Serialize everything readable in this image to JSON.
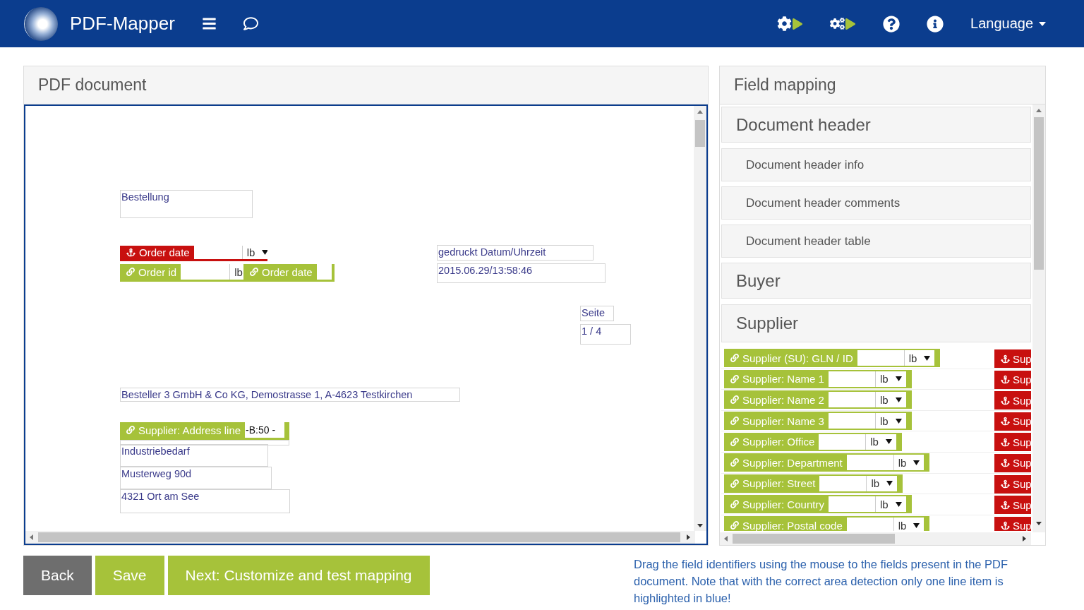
{
  "app": {
    "title": "PDF-Mapper",
    "language": "Language"
  },
  "pdf_panel": {
    "title": "PDF document",
    "items": [
      {
        "kind": "text",
        "text": "Bestellung"
      },
      {
        "kind": "anchor",
        "label": "Order date",
        "unit": "lb"
      },
      {
        "kind": "link",
        "label": "Order id",
        "unit": "lb"
      },
      {
        "kind": "link",
        "label": "Order date"
      },
      {
        "kind": "text",
        "text": "gedruckt Datum/Uhrzeit"
      },
      {
        "kind": "text",
        "text": "2015.06.29/13:58:46"
      },
      {
        "kind": "text",
        "text": "Seite"
      },
      {
        "kind": "text",
        "text": "1 / 4"
      },
      {
        "kind": "text",
        "text": "Besteller 3 GmbH & Co KG, Demostrasse 1, A-4623 Testkirchen"
      },
      {
        "kind": "link",
        "label": "Supplier: Address line",
        "value": "-B:50 -"
      },
      {
        "kind": "text",
        "text": "Industriebedarf"
      },
      {
        "kind": "text",
        "text": "Musterweg 90d"
      },
      {
        "kind": "text",
        "text": "4321 Ort am See"
      }
    ]
  },
  "mapping_panel": {
    "title": "Field mapping",
    "sections": [
      {
        "title": "Document header",
        "children": [
          {
            "title": "Document header info"
          },
          {
            "title": "Document header comments"
          },
          {
            "title": "Document header table"
          }
        ]
      },
      {
        "title": "Buyer"
      },
      {
        "title": "Supplier",
        "fields": [
          {
            "label": "Supplier (SU): GLN / ID",
            "unit": "lb",
            "anchor": "Sup"
          },
          {
            "label": "Supplier: Name 1",
            "unit": "lb",
            "anchor": "Sup"
          },
          {
            "label": "Supplier: Name 2",
            "unit": "lb",
            "anchor": "Sup"
          },
          {
            "label": "Supplier: Name 3",
            "unit": "lb",
            "anchor": "Sup"
          },
          {
            "label": "Supplier: Office",
            "unit": "lb",
            "anchor": "Sup"
          },
          {
            "label": "Supplier: Department",
            "unit": "lb",
            "anchor": "Sup"
          },
          {
            "label": "Supplier: Street",
            "unit": "lb",
            "anchor": "Sup"
          },
          {
            "label": "Supplier: Country",
            "unit": "lb",
            "anchor": "Sup"
          },
          {
            "label": "Supplier: Postal code",
            "unit": "lb",
            "anchor": "Sup"
          }
        ]
      }
    ]
  },
  "buttons": [
    {
      "kind": "back",
      "label": "Back"
    },
    {
      "kind": "primary",
      "label": "Save"
    },
    {
      "kind": "primary",
      "label": "Next: Customize and test mapping"
    }
  ],
  "hint": "Drag the field identifiers using the mouse to the fields present in the PDF document. Note that with the correct area detection only one line item is highlighted in blue!"
}
